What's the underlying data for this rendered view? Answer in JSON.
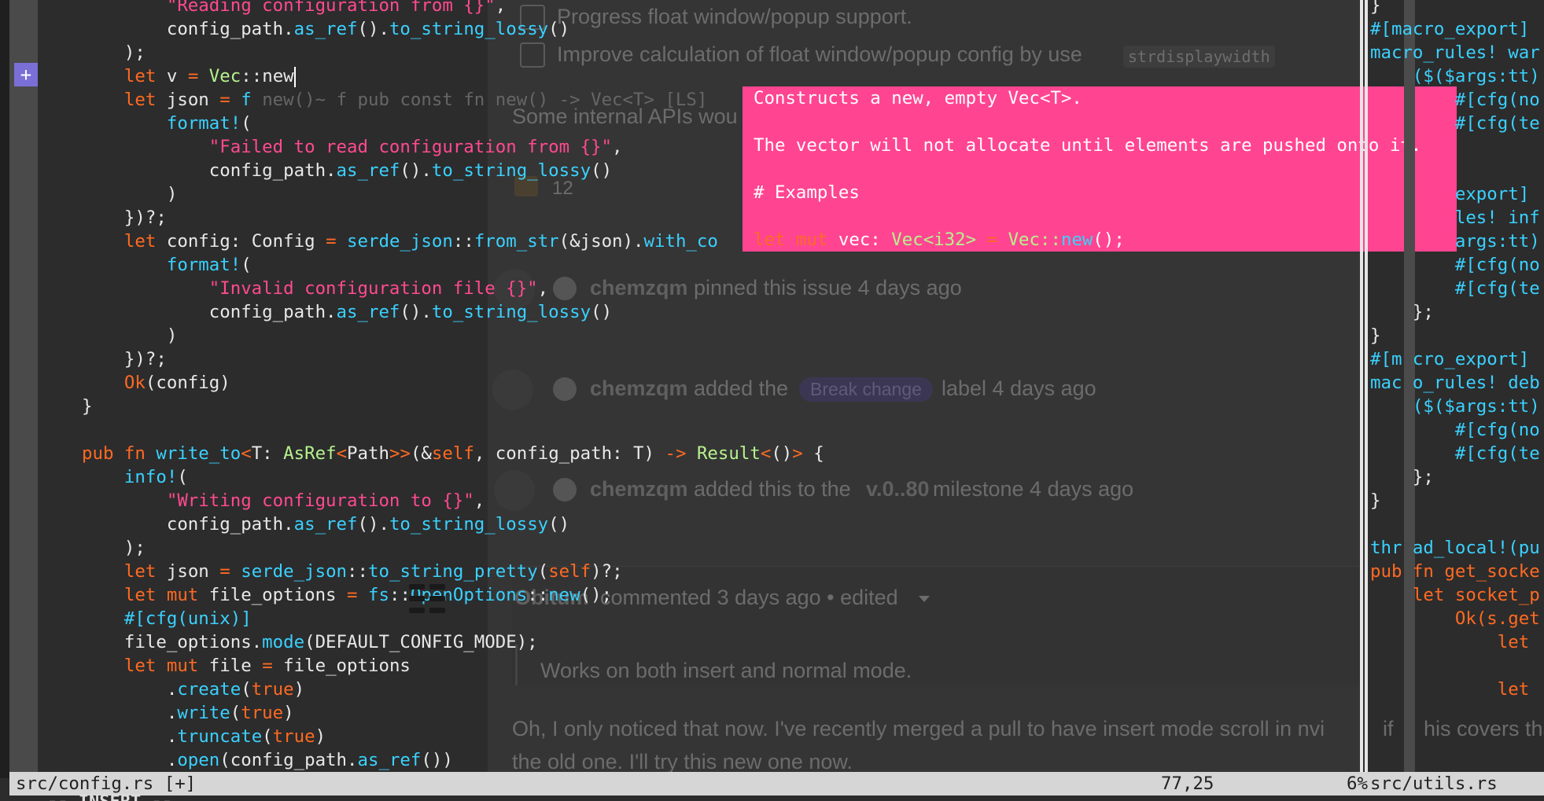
{
  "ghost": {
    "item1": "Progress float window/popup support.",
    "item2": "Improve calculation of float window/popup config by use",
    "item2_code": "strdisplaywidth",
    "para1": "Some internal APIs wou",
    "reaction_count": "12",
    "pin_user": "chemzqm",
    "pin_text": "pinned this issue 4 days ago",
    "label_user": "chemzqm",
    "label_pre": "added the",
    "label_name": "Break change",
    "label_post": "label 4 days ago",
    "milestone_user": "chemzqm",
    "milestone_pre": "added this to the",
    "milestone_name": "v.0..80",
    "milestone_post": "milestone 4 days ago",
    "comment_user": "Obitum",
    "comment_meta": "commented 3 days ago • edited",
    "quote": "Works on both insert and normal mode.",
    "reply1": "Oh, I only noticed that now. I've recently merged a pull to have insert mode scroll in nvi",
    "reply1b": "if",
    "reply1c": "his covers tha",
    "reply2": "the old one. I'll try this new one now."
  },
  "editor": {
    "sign": "+",
    "lines": [
      "\"Reading configuration from {}\",",
      "config_path.as_ref().to_string_lossy()"
    ],
    "completion_hint": "new()~ f pub const fn new() -> Vec<T> [LS]"
  },
  "popup": {
    "line1": "Constructs a new, empty Vec<T>.",
    "line2": "The vector will not allocate until elements are pushed onto it.",
    "line3": "# Examples",
    "line4_kw": "let mut",
    "line4_rest": " vec: ",
    "line4_ty": "Vec<i32>",
    "line4_eq": " = ",
    "line4_path": "Vec::",
    "line4_fn": "new",
    "line4_end": "();"
  },
  "right_pane": {
    "lines": [
      "}",
      "#[macro_export]",
      "macro_rules! war",
      "    ($($args:tt)",
      "        #[cfg(no",
      "        #[cfg(te",
      "",
      "",
      "        export]",
      "        les! inf",
      "        args:tt)",
      "        #[cfg(no",
      "        #[cfg(te",
      "    };",
      "}",
      "#[m cro_export]",
      "mac o_rules! deb",
      "    ($($args:tt)",
      "        #[cfg(no",
      "        #[cfg(te",
      "    };",
      "}",
      "",
      "thr ad_local!(pu",
      "pub fn get_socke",
      "    let socket_p",
      "        Ok(s.get",
      "            let",
      "",
      "            let"
    ]
  },
  "statusbar": {
    "file": "src/config.rs [+]",
    "position": "77,25",
    "percent": "6%",
    "right_file": "src/utils.rs"
  },
  "mode": "-- INSERT --",
  "colors": {
    "keyword": "#ff6a22",
    "function": "#3ad1ff",
    "string": "#ff4a8f",
    "type": "#b6f28e",
    "popup_bg": "#ff4591",
    "sign": "#7a6fd6"
  }
}
